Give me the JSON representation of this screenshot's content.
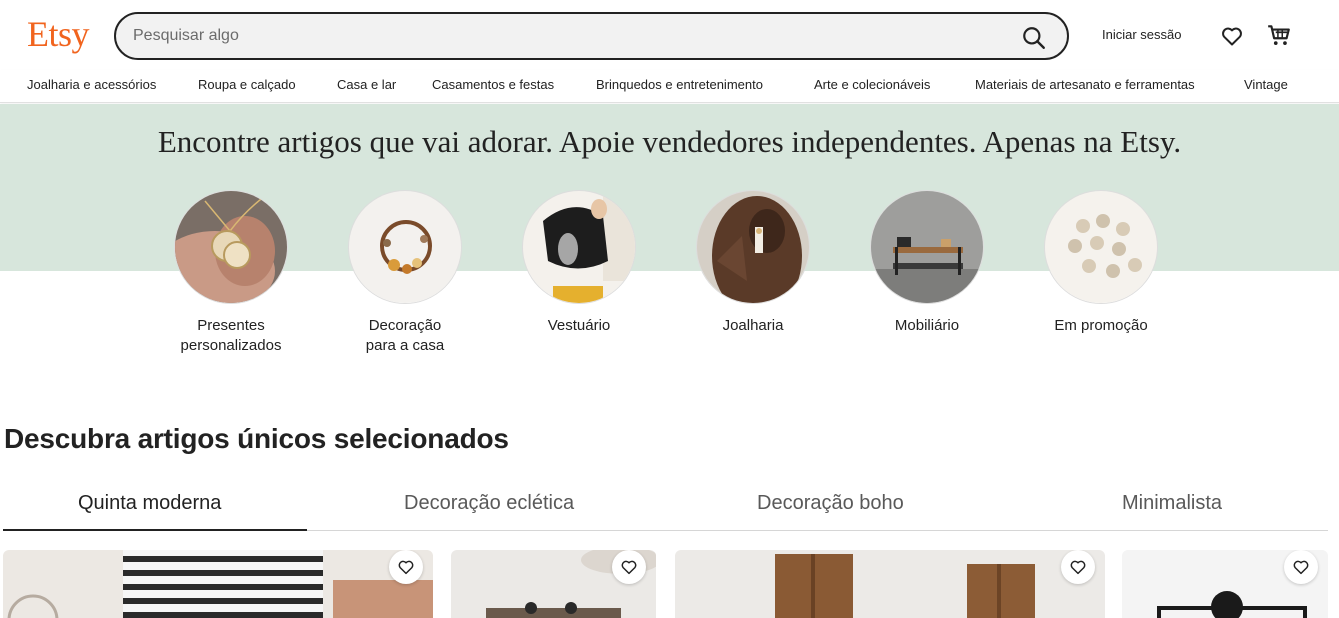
{
  "header": {
    "logo": "Etsy",
    "search_placeholder": "Pesquisar algo",
    "signin_label": "Iniciar sessão",
    "icons": [
      "search-icon",
      "heart-icon",
      "cart-icon"
    ]
  },
  "nav": {
    "items": [
      "Joalharia e acessórios",
      "Roupa e calçado",
      "Casa e lar",
      "Casamentos e festas",
      "Brinquedos e entretenimento",
      "Arte e colecionáveis",
      "Materiais de artesanato e ferramentas",
      "Vintage"
    ]
  },
  "hero": {
    "title": "Encontre artigos que vai adorar. Apoie vendedores independentes. Apenas na Etsy.",
    "categories": [
      {
        "label_line1": "Presentes",
        "label_line2": "personalizados"
      },
      {
        "label_line1": "Decoração",
        "label_line2": "para a casa"
      },
      {
        "label_line1": "Vestuário",
        "label_line2": ""
      },
      {
        "label_line1": "Joalharia",
        "label_line2": ""
      },
      {
        "label_line1": "Mobiliário",
        "label_line2": ""
      },
      {
        "label_line1": "Em promoção",
        "label_line2": ""
      }
    ]
  },
  "discover": {
    "title": "Descubra artigos únicos selecionados",
    "tabs": [
      "Quinta moderna",
      "Decoração eclética",
      "Decoração boho",
      "Minimalista"
    ],
    "active_tab": "Quinta moderna"
  },
  "colors": {
    "brand": "#f1641e",
    "hero_band": "#d7e6dc",
    "text": "#222222"
  }
}
